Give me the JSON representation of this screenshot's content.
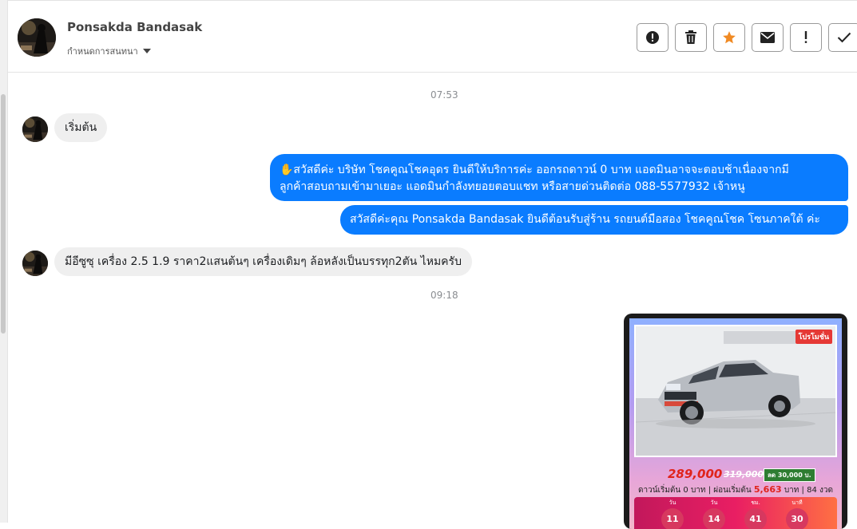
{
  "header": {
    "contact_name": "Ponsakda Bandasak",
    "conversation_setting": "กำหนดการสนทนา"
  },
  "actions": [
    {
      "name": "spam-button",
      "icon": "exclamation-circle-icon"
    },
    {
      "name": "delete-button",
      "icon": "trash-icon"
    },
    {
      "name": "star-button",
      "icon": "star-icon",
      "color": "#f08a24"
    },
    {
      "name": "mail-button",
      "icon": "envelope-icon"
    },
    {
      "name": "important-button",
      "icon": "exclamation-icon"
    },
    {
      "name": "done-button",
      "icon": "check-icon"
    }
  ],
  "messages": {
    "time_1": "07:53",
    "incoming_1": "เริ่มต้น",
    "outgoing_1_line1": "✋สวัสดีค่ะ บริษัท โชคคูณโชคอุดร ยินดีให้บริการค่ะ ออกรถดาวน์ 0 บาท แอดมินอาจจะตอบช้าเนื่องจากมี",
    "outgoing_1_line2": "ลูกค้าสอบถามเข้ามาเยอะ แอดมินกำลังทยอยตอบแชท หรือสายด่วนติดต่อ 088-5577932 เจ้าหนู",
    "outgoing_2": "สวัสดีค่ะคุณ Ponsakda Bandasak ยินดีต้อนรับสู่ร้าน รถยนต์มือสอง โชคคูณโชค โซนภาคใต้ ค่ะ",
    "incoming_2": "มีอีซูซุ เครื่อง 2.5 1.9  ราคา2แสนต้นๆ เครื่องเดิมๆ ล้อหลังเป็นบรรทุก2ตัน ไหมครับ",
    "time_2": "09:18"
  },
  "card": {
    "promo_tag": "โปรโมชั่น",
    "price_now": "289,000",
    "price_old": "319,000",
    "discount": "ลด 30,000 บ.",
    "terms_prefix": "ดาวน์เริ่มต้น 0 บาท | ผ่อนเริ่มต้น",
    "installment": "5,663",
    "terms_suffix": "บาท | 84 งวด",
    "countdown": [
      {
        "label": "วัน",
        "value": "11"
      },
      {
        "label": "วัน",
        "value": "14"
      },
      {
        "label": "ชม.",
        "value": "41"
      },
      {
        "label": "นาที",
        "value": "30"
      }
    ]
  }
}
